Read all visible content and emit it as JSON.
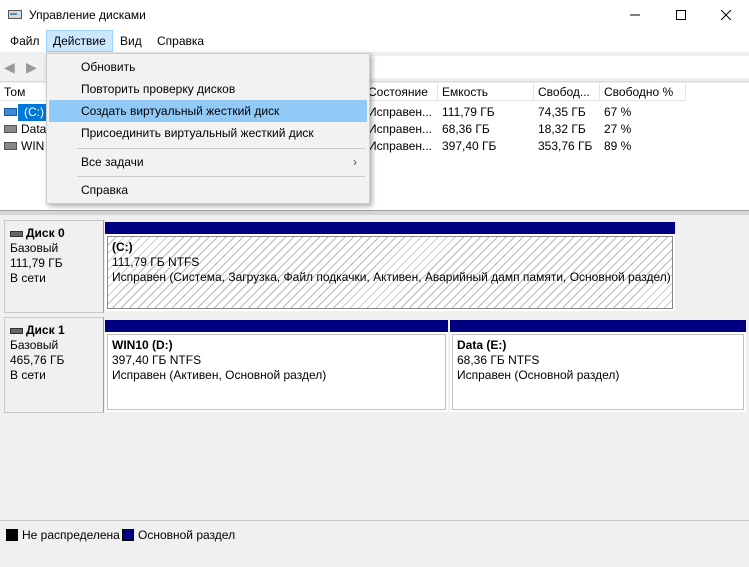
{
  "window": {
    "title": "Управление дисками",
    "minimize_icon": "minimize-icon",
    "maximize_icon": "maximize-icon",
    "close_icon": "close-icon"
  },
  "menu": {
    "file": "Файл",
    "action": "Действие",
    "view": "Вид",
    "help": "Справка"
  },
  "toolbar": {
    "back_icon": "arrow-left-icon",
    "forward_icon": "arrow-right-icon"
  },
  "action_menu": {
    "items": [
      "Обновить",
      "Повторить проверку дисков",
      "Создать виртуальный жесткий диск",
      "Присоединить виртуальный жесткий диск",
      "Все задачи",
      "Справка"
    ],
    "highlighted": "Создать виртуальный жесткий диск"
  },
  "volumes": {
    "columns": [
      "Том",
      "Состояние",
      "Емкость",
      "Свобод...",
      "Свободно %"
    ],
    "rows": [
      {
        "name": "(C:)",
        "status": "Исправен...",
        "capacity": "111,79 ГБ",
        "free": "74,35 ГБ",
        "free_pct": "67 %"
      },
      {
        "name": "Data",
        "status": "Исправен...",
        "capacity": "68,36 ГБ",
        "free": "18,32 ГБ",
        "free_pct": "27 %"
      },
      {
        "name": "WIN",
        "status": "Исправен...",
        "capacity": "397,40 ГБ",
        "free": "353,76 ГБ",
        "free_pct": "89 %"
      }
    ]
  },
  "disks": [
    {
      "name": "Диск 0",
      "type": "Базовый",
      "size": "111,79 ГБ",
      "state": "В сети",
      "partitions": [
        {
          "title": "(C:)",
          "fs": "111,79 ГБ NTFS",
          "status": "Исправен (Система, Загрузка, Файл подкачки, Активен, Аварийный дамп памяти, Основной раздел)"
        }
      ]
    },
    {
      "name": "Диск 1",
      "type": "Базовый",
      "size": "465,76 ГБ",
      "state": "В сети",
      "partitions": [
        {
          "title": "WIN10  (D:)",
          "fs": "397,40 ГБ NTFS",
          "status": "Исправен (Активен, Основной раздел)"
        },
        {
          "title": "Data  (E:)",
          "fs": "68,36 ГБ NTFS",
          "status": "Исправен (Основной раздел)"
        }
      ]
    }
  ],
  "legend": {
    "unallocated": "Не распределена",
    "primary": "Основной раздел",
    "unallocated_color": "#000000",
    "primary_color": "#000080"
  }
}
